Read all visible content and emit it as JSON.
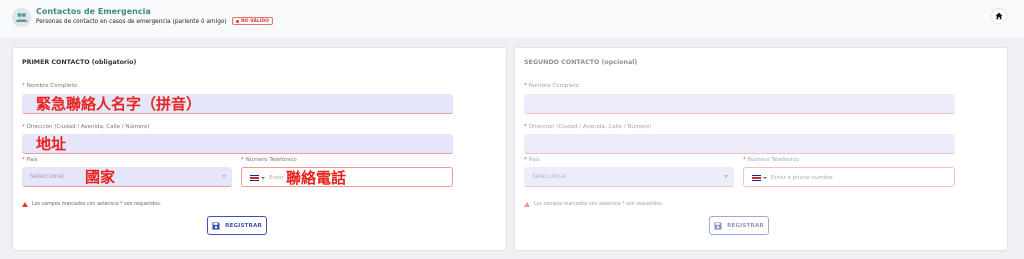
{
  "colors": {
    "accent": "#3d8a82",
    "danger": "#e53935",
    "primary": "#3f51b5",
    "field": "#e6e6fb"
  },
  "header": {
    "title": "Contactos de Emergencia",
    "subtitle": "Personas de contacto en casos de emergencia (pariente ó amigo)",
    "badge": "NO VÁLIDO",
    "avatar_icon": "users-icon",
    "home_icon": "home-icon"
  },
  "primary": {
    "title": "PRIMER CONTACTO (obligatorio)",
    "name_label": "Nombre Completo",
    "name_value": "緊急聯絡人名字（拼音）",
    "address_label": "Dirección (Ciudad / Avenida, Calle / Número)",
    "address_value": "地址",
    "country_label": "País",
    "country_placeholder": "Seleccionar",
    "country_overlay": "國家",
    "phone_label": "Número Telefónico",
    "phone_placeholder": "Enter",
    "phone_overlay": "聯絡電話",
    "note": "Los campos marcados con asterisco * son requeridos.",
    "button": "REGISTRAR"
  },
  "secondary": {
    "title": "SEGUNDO CONTACTO (opcional)",
    "name_label": "Nombre Completo",
    "address_label": "Dirección (Ciudad / Avenida, Calle / Número)",
    "country_label": "País",
    "country_placeholder": "Seleccionar",
    "phone_label": "Número Telefónico",
    "phone_placeholder": "Enter a phone number",
    "note": "Los campos marcados con asterisco * son requeridos.",
    "button": "REGISTRAR"
  },
  "asterisk": "*"
}
